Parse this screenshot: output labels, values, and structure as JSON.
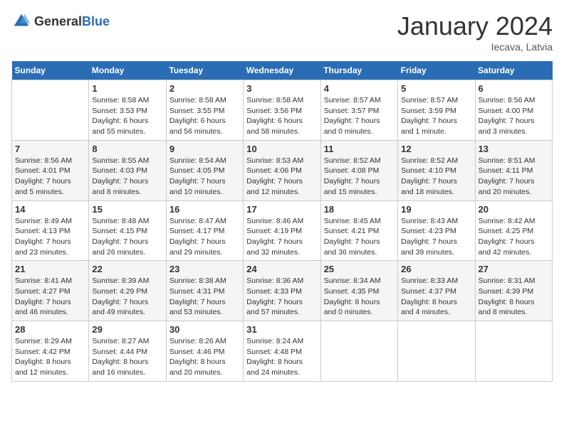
{
  "logo": {
    "text_general": "General",
    "text_blue": "Blue"
  },
  "title": "January 2024",
  "location": "Iecava, Latvia",
  "days_of_week": [
    "Sunday",
    "Monday",
    "Tuesday",
    "Wednesday",
    "Thursday",
    "Friday",
    "Saturday"
  ],
  "weeks": [
    [
      {
        "day": "",
        "info": ""
      },
      {
        "day": "1",
        "info": "Sunrise: 8:58 AM\nSunset: 3:53 PM\nDaylight: 6 hours\nand 55 minutes."
      },
      {
        "day": "2",
        "info": "Sunrise: 8:58 AM\nSunset: 3:55 PM\nDaylight: 6 hours\nand 56 minutes."
      },
      {
        "day": "3",
        "info": "Sunrise: 8:58 AM\nSunset: 3:56 PM\nDaylight: 6 hours\nand 58 minutes."
      },
      {
        "day": "4",
        "info": "Sunrise: 8:57 AM\nSunset: 3:57 PM\nDaylight: 7 hours\nand 0 minutes."
      },
      {
        "day": "5",
        "info": "Sunrise: 8:57 AM\nSunset: 3:59 PM\nDaylight: 7 hours\nand 1 minute."
      },
      {
        "day": "6",
        "info": "Sunrise: 8:56 AM\nSunset: 4:00 PM\nDaylight: 7 hours\nand 3 minutes."
      }
    ],
    [
      {
        "day": "7",
        "info": "Sunrise: 8:56 AM\nSunset: 4:01 PM\nDaylight: 7 hours\nand 5 minutes."
      },
      {
        "day": "8",
        "info": "Sunrise: 8:55 AM\nSunset: 4:03 PM\nDaylight: 7 hours\nand 8 minutes."
      },
      {
        "day": "9",
        "info": "Sunrise: 8:54 AM\nSunset: 4:05 PM\nDaylight: 7 hours\nand 10 minutes."
      },
      {
        "day": "10",
        "info": "Sunrise: 8:53 AM\nSunset: 4:06 PM\nDaylight: 7 hours\nand 12 minutes."
      },
      {
        "day": "11",
        "info": "Sunrise: 8:52 AM\nSunset: 4:08 PM\nDaylight: 7 hours\nand 15 minutes."
      },
      {
        "day": "12",
        "info": "Sunrise: 8:52 AM\nSunset: 4:10 PM\nDaylight: 7 hours\nand 18 minutes."
      },
      {
        "day": "13",
        "info": "Sunrise: 8:51 AM\nSunset: 4:11 PM\nDaylight: 7 hours\nand 20 minutes."
      }
    ],
    [
      {
        "day": "14",
        "info": "Sunrise: 8:49 AM\nSunset: 4:13 PM\nDaylight: 7 hours\nand 23 minutes."
      },
      {
        "day": "15",
        "info": "Sunrise: 8:48 AM\nSunset: 4:15 PM\nDaylight: 7 hours\nand 26 minutes."
      },
      {
        "day": "16",
        "info": "Sunrise: 8:47 AM\nSunset: 4:17 PM\nDaylight: 7 hours\nand 29 minutes."
      },
      {
        "day": "17",
        "info": "Sunrise: 8:46 AM\nSunset: 4:19 PM\nDaylight: 7 hours\nand 32 minutes."
      },
      {
        "day": "18",
        "info": "Sunrise: 8:45 AM\nSunset: 4:21 PM\nDaylight: 7 hours\nand 36 minutes."
      },
      {
        "day": "19",
        "info": "Sunrise: 8:43 AM\nSunset: 4:23 PM\nDaylight: 7 hours\nand 39 minutes."
      },
      {
        "day": "20",
        "info": "Sunrise: 8:42 AM\nSunset: 4:25 PM\nDaylight: 7 hours\nand 42 minutes."
      }
    ],
    [
      {
        "day": "21",
        "info": "Sunrise: 8:41 AM\nSunset: 4:27 PM\nDaylight: 7 hours\nand 46 minutes."
      },
      {
        "day": "22",
        "info": "Sunrise: 8:39 AM\nSunset: 4:29 PM\nDaylight: 7 hours\nand 49 minutes."
      },
      {
        "day": "23",
        "info": "Sunrise: 8:38 AM\nSunset: 4:31 PM\nDaylight: 7 hours\nand 53 minutes."
      },
      {
        "day": "24",
        "info": "Sunrise: 8:36 AM\nSunset: 4:33 PM\nDaylight: 7 hours\nand 57 minutes."
      },
      {
        "day": "25",
        "info": "Sunrise: 8:34 AM\nSunset: 4:35 PM\nDaylight: 8 hours\nand 0 minutes."
      },
      {
        "day": "26",
        "info": "Sunrise: 8:33 AM\nSunset: 4:37 PM\nDaylight: 8 hours\nand 4 minutes."
      },
      {
        "day": "27",
        "info": "Sunrise: 8:31 AM\nSunset: 4:39 PM\nDaylight: 8 hours\nand 8 minutes."
      }
    ],
    [
      {
        "day": "28",
        "info": "Sunrise: 8:29 AM\nSunset: 4:42 PM\nDaylight: 8 hours\nand 12 minutes."
      },
      {
        "day": "29",
        "info": "Sunrise: 8:27 AM\nSunset: 4:44 PM\nDaylight: 8 hours\nand 16 minutes."
      },
      {
        "day": "30",
        "info": "Sunrise: 8:26 AM\nSunset: 4:46 PM\nDaylight: 8 hours\nand 20 minutes."
      },
      {
        "day": "31",
        "info": "Sunrise: 8:24 AM\nSunset: 4:48 PM\nDaylight: 8 hours\nand 24 minutes."
      },
      {
        "day": "",
        "info": ""
      },
      {
        "day": "",
        "info": ""
      },
      {
        "day": "",
        "info": ""
      }
    ]
  ]
}
